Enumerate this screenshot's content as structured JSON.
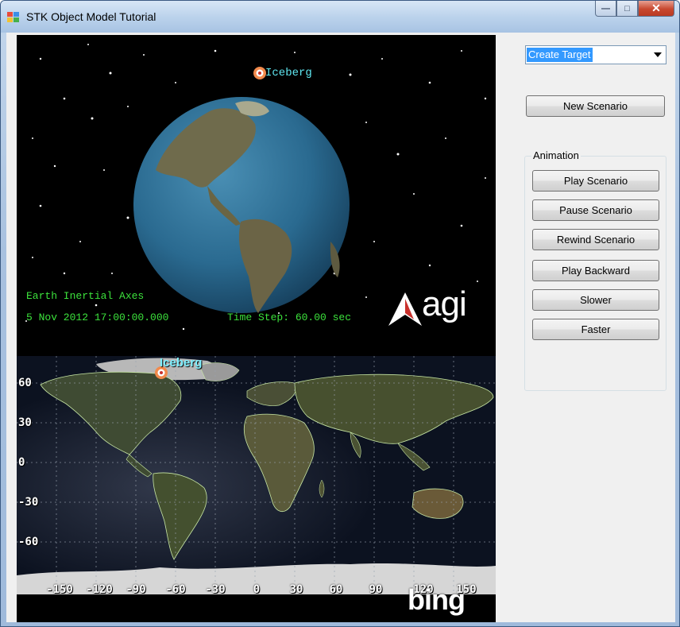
{
  "window": {
    "title": "STK Object Model Tutorial",
    "buttons": {
      "minimize": "—",
      "maximize": "□",
      "close": "✕"
    }
  },
  "globe_view": {
    "target_label": "Iceberg",
    "axes_label": "Earth Inertial Axes",
    "date_time": "5 Nov 2012 17:00:00.000",
    "time_step": "Time Step: 60.00 sec",
    "logo_text": "agi"
  },
  "map_view": {
    "target_label": "Iceberg",
    "lat_labels": [
      "60",
      "30",
      "0",
      "-30",
      "-60"
    ],
    "lon_labels": [
      "-150",
      "-120",
      "-90",
      "-60",
      "-30",
      "0",
      "30",
      "60",
      "90",
      "120",
      "150"
    ],
    "logo_text": "bing"
  },
  "side_panel": {
    "object_select": {
      "value": "Create Target"
    },
    "new_scenario_button": "New Scenario",
    "animation_group": {
      "label": "Animation",
      "buttons": [
        "Play Scenario",
        "Pause Scenario",
        "Rewind Scenario",
        "Play Backward",
        "Slower",
        "Faster"
      ]
    }
  },
  "colors": {
    "hud_text": "#3ce23c",
    "target_label": "#5fe8f2",
    "selection": "#3399ff"
  }
}
